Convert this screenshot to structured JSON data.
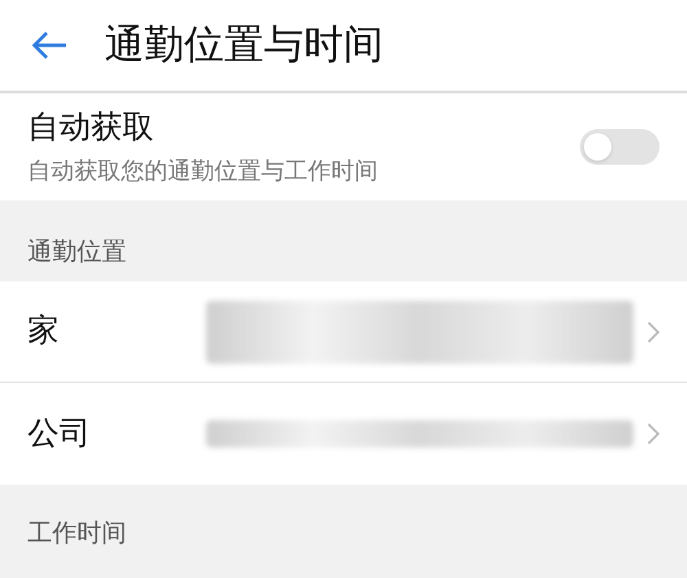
{
  "header": {
    "title": "通勤位置与时间"
  },
  "auto_fetch": {
    "title": "自动获取",
    "subtitle": "自动获取您的通勤位置与工作时间",
    "on": false
  },
  "sections": [
    {
      "title": "通勤位置",
      "rows": [
        {
          "label": "家"
        },
        {
          "label": "公司"
        }
      ]
    },
    {
      "title": "工作时间"
    }
  ]
}
